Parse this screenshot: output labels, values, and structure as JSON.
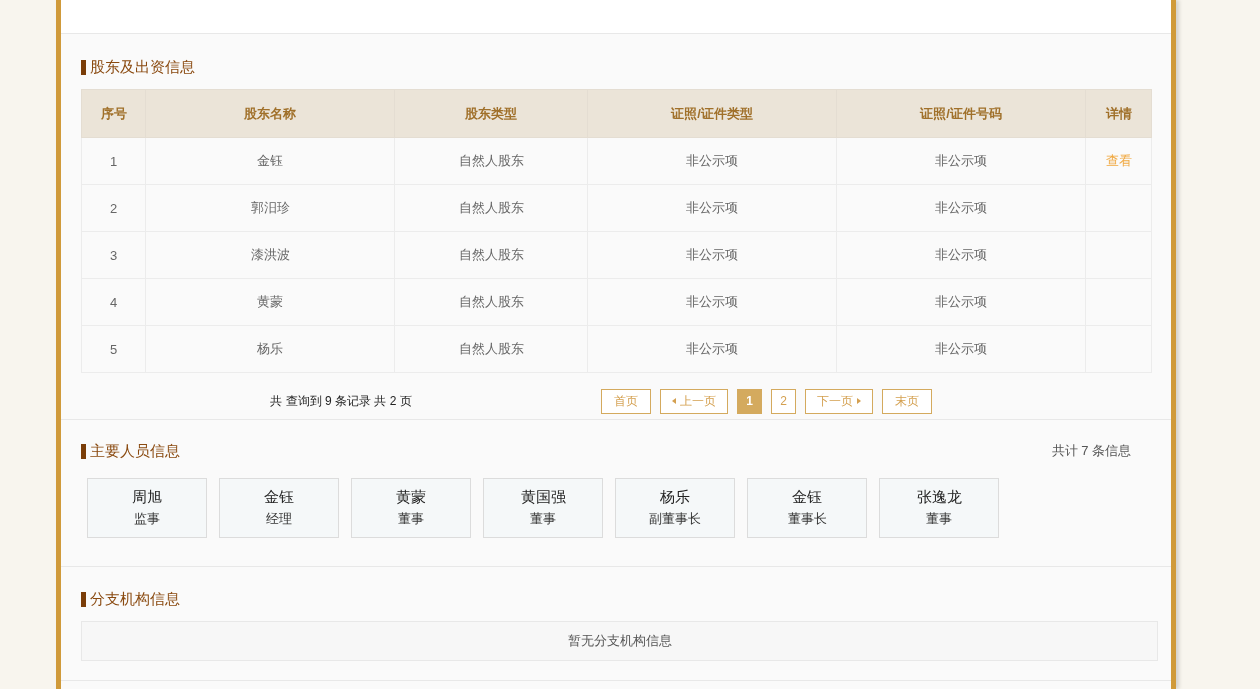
{
  "shareholders": {
    "title": "股东及出资信息",
    "table": {
      "columns": [
        "序号",
        "股东名称",
        "股东类型",
        "证照/证件类型",
        "证照/证件号码",
        "详情"
      ],
      "rows": [
        {
          "no": "1",
          "name": "金钰",
          "type": "自然人股东",
          "id_type": "非公示项",
          "id_no": "非公示项",
          "detail": "查看"
        },
        {
          "no": "2",
          "name": "郭汨珍",
          "type": "自然人股东",
          "id_type": "非公示项",
          "id_no": "非公示项"
        },
        {
          "no": "3",
          "name": "漆洪波",
          "type": "自然人股东",
          "id_type": "非公示项",
          "id_no": "非公示项"
        },
        {
          "no": "4",
          "name": "黄蒙",
          "type": "自然人股东",
          "id_type": "非公示项",
          "id_no": "非公示项"
        },
        {
          "no": "5",
          "name": "杨乐",
          "type": "自然人股东",
          "id_type": "非公示项",
          "id_no": "非公示项"
        }
      ]
    },
    "pagination": {
      "summary": "共 查询到 9 条记录 共 2 页",
      "first": "首页",
      "prev": "上一页",
      "pages": [
        {
          "label": "1",
          "selected": true
        },
        {
          "label": "2",
          "selected": false
        }
      ],
      "next": "下一页",
      "last": "末页"
    }
  },
  "key_personnel": {
    "title": "主要人员信息",
    "count": "共计 7 条信息",
    "people": [
      {
        "name": "周旭",
        "role": "监事"
      },
      {
        "name": "金钰",
        "role": "经理"
      },
      {
        "name": "黄蒙",
        "role": "董事"
      },
      {
        "name": "黄国强",
        "role": "董事"
      },
      {
        "name": "杨乐",
        "role": "副董事长"
      },
      {
        "name": "金钰",
        "role": "董事长"
      },
      {
        "name": "张逸龙",
        "role": "董事"
      }
    ]
  },
  "branches": {
    "title": "分支机构信息",
    "empty_message": "暂无分支机构信息"
  }
}
